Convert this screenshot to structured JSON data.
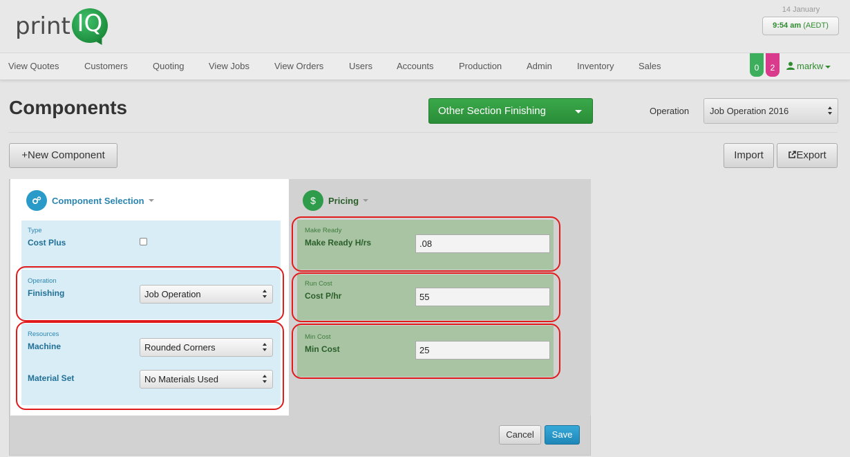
{
  "brand": {
    "logo_text_left": "print",
    "logo_text_right": "IQ"
  },
  "clock": {
    "date": "14 January",
    "time": "9:54 am",
    "tz": "(AEDT)"
  },
  "nav": {
    "items": [
      "View Quotes",
      "Customers",
      "Quoting",
      "View Jobs",
      "View Orders",
      "Users",
      "Accounts",
      "Production",
      "Admin",
      "Inventory",
      "Sales"
    ],
    "badge_green": "0",
    "badge_pink": "2",
    "user": "markw"
  },
  "page": {
    "title": "Components",
    "section_dropdown": "Other Section Finishing",
    "operation_label": "Operation",
    "operation_value": "Job Operation 2016",
    "new_component": "+New Component",
    "import": "Import",
    "export": "Export"
  },
  "component_selection": {
    "heading": "Component Selection",
    "type_label": "Type",
    "type_field": "Cost Plus",
    "operation_label": "Operation",
    "operation_field": "Finishing",
    "operation_value": "Job Operation",
    "resources_label": "Resources",
    "machine_field": "Machine",
    "machine_value": "Rounded Corners",
    "material_field": "Material Set",
    "material_value": "No Materials Used"
  },
  "pricing": {
    "heading": "Pricing",
    "make_ready_label": "Make Ready",
    "make_ready_field": "Make Ready H/rs",
    "make_ready_value": ".08",
    "run_cost_label": "Run Cost",
    "run_cost_field": "Cost P/hr",
    "run_cost_value": "55",
    "min_cost_label": "Min Cost",
    "min_cost_field": "Min Cost",
    "min_cost_value": "25"
  },
  "actions": {
    "cancel": "Cancel",
    "save": "Save"
  },
  "colors": {
    "accent_green": "#2e9c4a",
    "accent_blue": "#2a9bc9",
    "highlight_red": "#e11b1b"
  }
}
